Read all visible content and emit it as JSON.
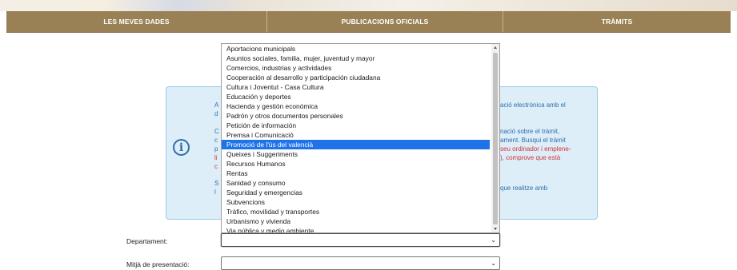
{
  "nav": {
    "items": [
      "LES MEVES DADES",
      "PUBLICACIONS OFICIALS",
      "TRÀMITS"
    ]
  },
  "info": {
    "lines_right": [
      "ació electrònica amb el",
      "nació sobre el tràmit,",
      "ament. Busqui el tràmit",
      "seu ordinador i emplene-",
      "), comprove que està",
      "que realitze amb"
    ],
    "left_fragments": [
      "A",
      "d",
      "C",
      "c",
      "p",
      "li",
      "c",
      "S",
      "l"
    ]
  },
  "listbox": {
    "options": [
      "Aportacions municipals",
      "Asuntos sociales, familia, mujer, juventud y mayor",
      "Comercios, industrias y actividades",
      "Cooperación al desarrollo y participación ciudadana",
      "Cultura i Joventut - Casa Cultura",
      "Educación y deportes",
      "Hacienda y gestión económica",
      "Padrón y otros documentos personales",
      "Petición de información",
      "Premsa i Comunicació",
      "Promoció de l'ús del valencià",
      "Queixes i Suggeriments",
      "Recursos Humanos",
      "Rentas",
      "Sanidad y consumo",
      "Seguridad y emergencias",
      "Subvencions",
      "Tráfico, movilidad y transportes",
      "Urbanismo y vivienda",
      "Via pública y medio ambiente"
    ],
    "selected": "Promoció de l'ús del valencià"
  },
  "form": {
    "department_label": "Departament:",
    "department_value": "",
    "medium_label": "Mitjà de presentació:",
    "medium_value": ""
  },
  "colors": {
    "nav_bg": "#9a8155",
    "info_bg": "#ddeef9",
    "info_border": "#9ccbe8",
    "info_blue": "#2f6ea6",
    "info_red": "#d1343a",
    "selected_option": "#1e73e8"
  },
  "icons": {
    "info": "info-circle-icon",
    "dropdown": "chevron-down-icon"
  }
}
